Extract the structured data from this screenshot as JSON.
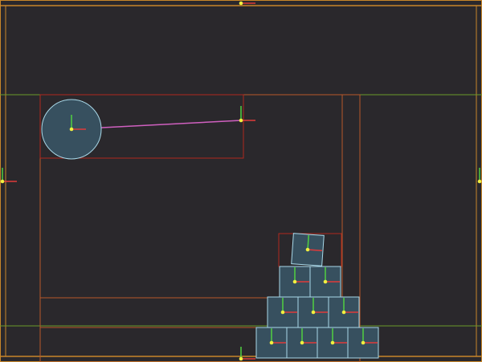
{
  "scene": {
    "background": "#2a282c",
    "colors": {
      "boundary": "#c8862a",
      "bbox": "#b0281e",
      "green_line": "#6a9a2a",
      "body_fill": "#37505f",
      "body_stroke": "#a8d8e8",
      "axis_x": "#e03a3a",
      "axis_y": "#50d040",
      "anchor": "#f0f040",
      "joint": "#d060c0"
    },
    "bodies": {
      "ball": {
        "shape": "circle"
      },
      "boxes": [
        {
          "shape": "box",
          "row": 1
        },
        {
          "shape": "box",
          "row": 1
        },
        {
          "shape": "box",
          "row": 1
        },
        {
          "shape": "box",
          "row": 1
        },
        {
          "shape": "box",
          "row": 2
        },
        {
          "shape": "box",
          "row": 2
        },
        {
          "shape": "box",
          "row": 2
        },
        {
          "shape": "box",
          "row": 3
        },
        {
          "shape": "box",
          "row": 3
        },
        {
          "shape": "box",
          "row": 4
        }
      ]
    },
    "joints": [
      {
        "type": "distance-joint",
        "from": "ball",
        "to": "anchor"
      }
    ]
  }
}
